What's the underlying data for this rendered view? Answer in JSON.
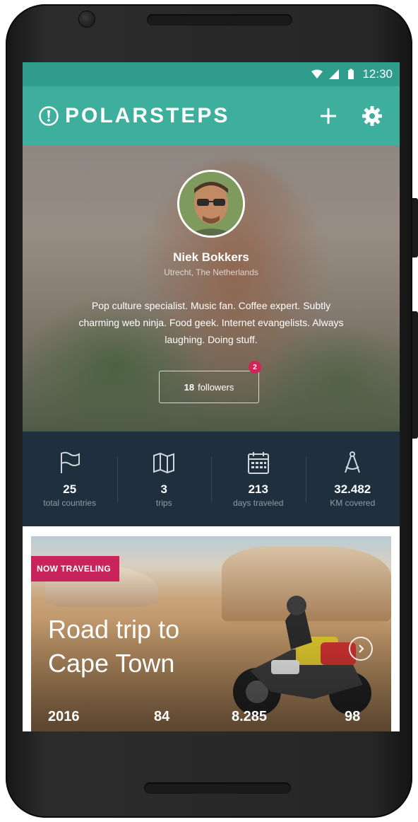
{
  "status_bar": {
    "time": "12:30"
  },
  "app_bar": {
    "logo_text": "POLARSTEPS",
    "icons": {
      "add": "plus-icon",
      "settings": "gear-icon",
      "logo": "compass-logo-icon"
    }
  },
  "profile": {
    "name": "Niek Bokkers",
    "location": "Utrecht, The Netherlands",
    "bio": "Pop culture specialist. Music fan. Coffee expert. Subtly charming web ninja. Food geek. Internet evangelists. Always laughing. Doing stuff.",
    "followers_count": "18",
    "followers_label": "followers",
    "followers_badge": "2"
  },
  "stats": [
    {
      "value": "25",
      "label": "total countries",
      "icon": "flag-icon"
    },
    {
      "value": "3",
      "label": "trips",
      "icon": "map-icon"
    },
    {
      "value": "213",
      "label": "days traveled",
      "icon": "calendar-icon"
    },
    {
      "value": "32.482",
      "label": "KM covered",
      "icon": "compass-icon"
    }
  ],
  "trip": {
    "badge": "NOW TRAVELING",
    "title": "Road trip to Cape Town",
    "stats": [
      "2016",
      "84",
      "8.285",
      "98"
    ]
  },
  "colors": {
    "status_bar": "#2f9c8c",
    "app_bar": "#3eae9d",
    "stats_bg": "#1f2f3e",
    "accent": "#c8235a"
  }
}
